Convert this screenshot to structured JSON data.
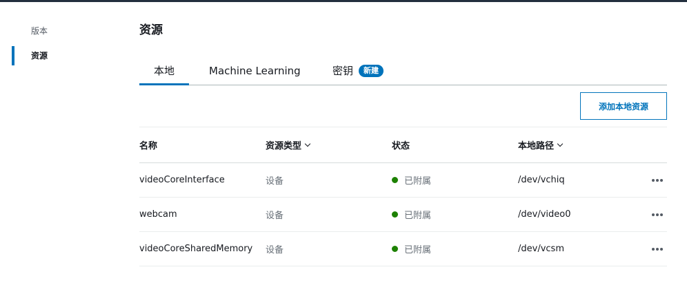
{
  "sidebar": {
    "items": [
      {
        "label": "版本"
      },
      {
        "label": "资源"
      }
    ]
  },
  "page": {
    "title": "资源"
  },
  "tabs": [
    {
      "label": "本地"
    },
    {
      "label": "Machine Learning"
    },
    {
      "label": "密钥",
      "badge": "新建"
    }
  ],
  "actions": {
    "add_local_resource": "添加本地资源"
  },
  "table": {
    "headers": {
      "name": "名称",
      "type": "资源类型",
      "status": "状态",
      "path": "本地路径"
    },
    "rows": [
      {
        "name": "videoCoreInterface",
        "type": "设备",
        "status": "已附属",
        "path": "/dev/vchiq"
      },
      {
        "name": "webcam",
        "type": "设备",
        "status": "已附属",
        "path": "/dev/video0"
      },
      {
        "name": "videoCoreSharedMemory",
        "type": "设备",
        "status": "已附属",
        "path": "/dev/vcsm"
      }
    ]
  },
  "colors": {
    "accent": "#0073bb",
    "status_ok": "#1d8102"
  }
}
